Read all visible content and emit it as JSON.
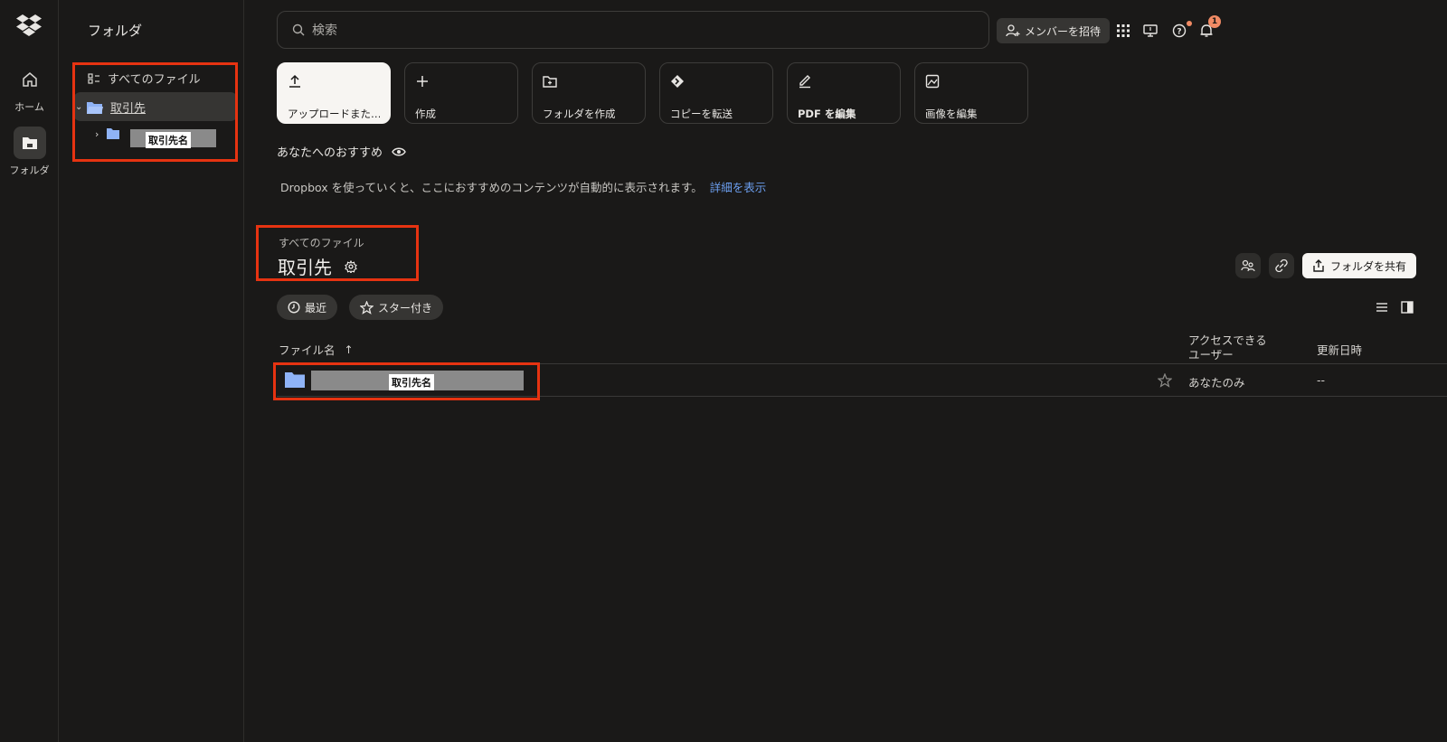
{
  "rail": {
    "items": [
      {
        "label": "ホーム",
        "icon": "home-icon"
      },
      {
        "label": "フォルダ",
        "icon": "folder-icon"
      }
    ]
  },
  "folder_panel": {
    "title": "フォルダ",
    "all_files": "すべてのファイル",
    "root_folder": "取引先",
    "child_label": "取引先名"
  },
  "header": {
    "search_placeholder": "検索",
    "invite_label": "メンバーを招待",
    "notification_count": "1"
  },
  "actions": [
    {
      "label": "アップロードまた…",
      "icon": "upload-icon"
    },
    {
      "label": "作成",
      "icon": "plus-icon"
    },
    {
      "label": "フォルダを作成",
      "icon": "folder-plus-icon"
    },
    {
      "label": "コピーを転送",
      "icon": "transfer-icon"
    },
    {
      "label": "PDF を編集",
      "icon": "pdf-edit-icon"
    },
    {
      "label": "画像を編集",
      "icon": "image-edit-icon"
    }
  ],
  "recommend": {
    "title": "あなたへのおすすめ",
    "text": "Dropbox を使っていくと、ここにおすすめのコンテンツが自動的に表示されます。",
    "link": "詳細を表示"
  },
  "folder": {
    "breadcrumb": "すべてのファイル",
    "title": "取引先",
    "share_label": "フォルダを共有"
  },
  "filters": {
    "recent": "最近",
    "starred": "スター付き"
  },
  "table": {
    "col_name": "ファイル名",
    "col_access_1": "アクセスできる",
    "col_access_2": "ユーザー",
    "col_modified": "更新日時",
    "rows": [
      {
        "name_label": "取引先名",
        "access": "あなたのみ",
        "modified": "--"
      }
    ]
  },
  "colors": {
    "background": "#1a1918",
    "highlight": "#e63311",
    "link": "#6c9ff0",
    "folder_blue": "#8fb3f6"
  }
}
